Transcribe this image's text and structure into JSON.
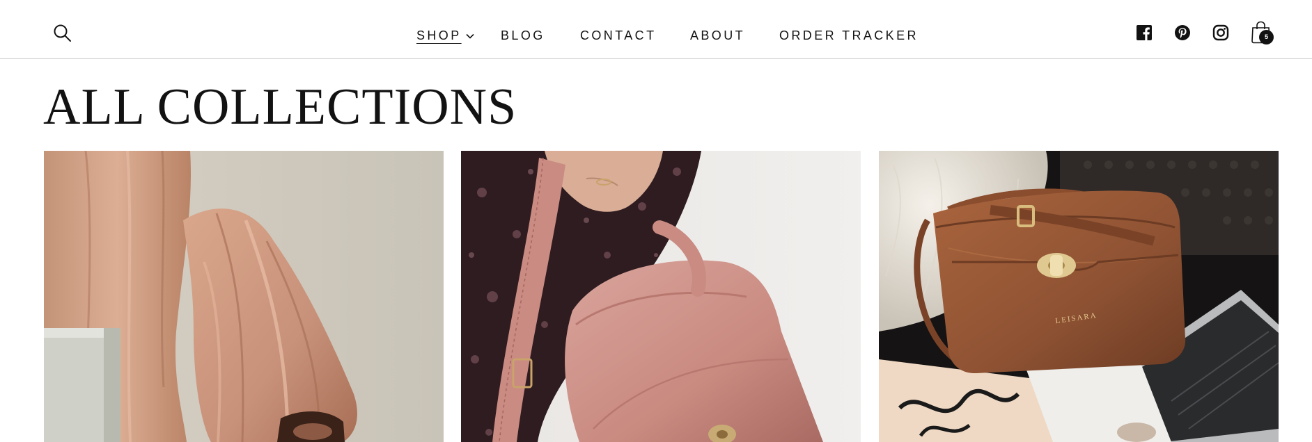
{
  "header": {
    "nav": [
      {
        "label": "SHOP",
        "has_dropdown": true,
        "active": true
      },
      {
        "label": "BLOG"
      },
      {
        "label": "CONTACT"
      },
      {
        "label": "ABOUT"
      },
      {
        "label": "ORDER TRACKER"
      }
    ],
    "icons": [
      "search-icon",
      "facebook-icon",
      "pinterest-icon",
      "instagram-icon",
      "cart-icon"
    ],
    "cart_count": "5"
  },
  "main": {
    "title": "ALL COLLECTIONS",
    "collections": [
      {
        "image": "pleated-blush-blouse-sleeve"
      },
      {
        "image": "pink-leather-handbag-held"
      },
      {
        "image": "brown-leather-crossbody-bag-on-fur",
        "bag_label": "LEISARA"
      }
    ]
  },
  "colors": {
    "text": "#121212",
    "divider": "#cfcfcf",
    "blush": "#c99a80",
    "pink_leather": "#c98d85",
    "cognac": "#8e5233"
  }
}
